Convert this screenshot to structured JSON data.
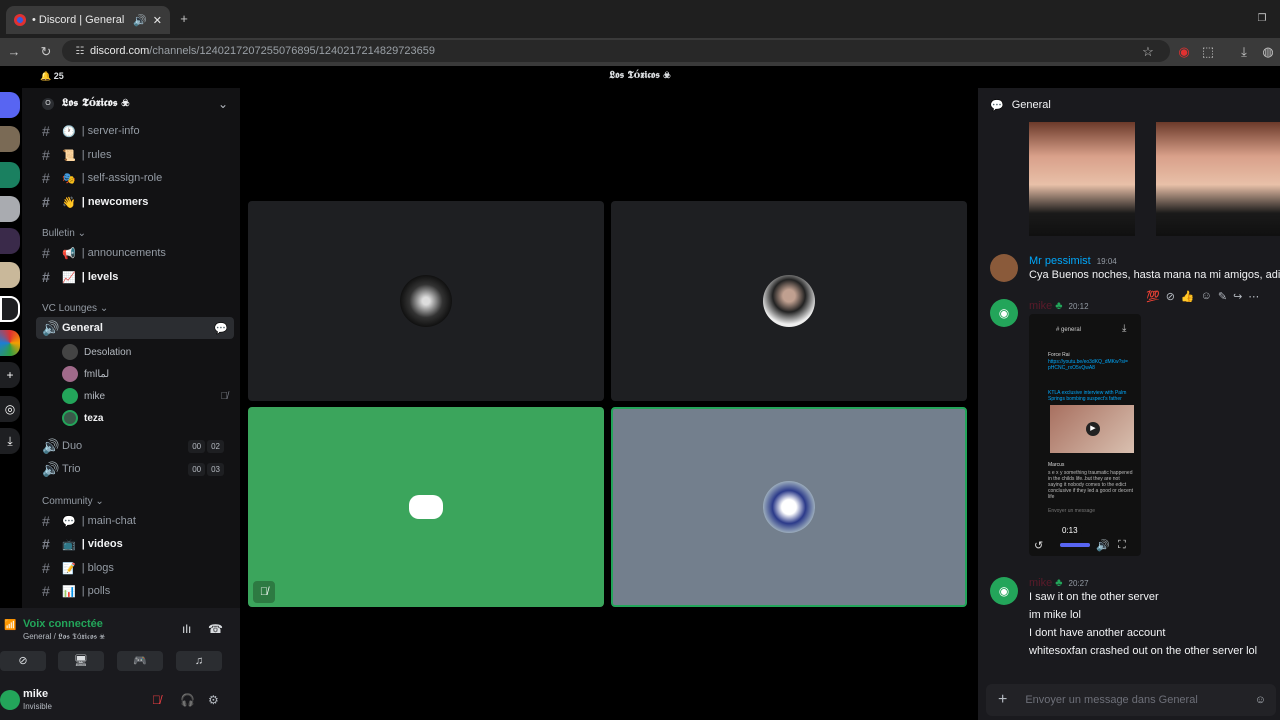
{
  "browser": {
    "tab_title": "• Discord | General | 𝕷𝖔𝖘 𝕿ó...",
    "url_host": "discord.com",
    "url_path": "/channels/1240217207255076895/1240217214829723659"
  },
  "top": {
    "notif_count": "25",
    "server_title": "𝕷𝖔𝖘 𝕿ó𝖝𝖎𝖈𝖔𝖘 ☣"
  },
  "sidebar": {
    "server_name": "𝕷𝖔𝖘 𝕿ó𝖝𝖎𝖈𝖔𝖘 ☣",
    "channels": [
      {
        "label": "| server-info",
        "emoji": "🕐"
      },
      {
        "label": "| rules",
        "emoji": "📜"
      },
      {
        "label": "| self-assign-role",
        "emoji": "🎭"
      },
      {
        "label": "| newcomers",
        "emoji": "👋"
      }
    ],
    "cat_bulletin": "Bulletin",
    "bulletin": [
      {
        "label": "| announcements",
        "emoji": "📢"
      },
      {
        "label": "| levels",
        "emoji": "📈"
      }
    ],
    "cat_vc": "VC Lounges",
    "vc_general": "General",
    "voice_users": [
      "Desolation",
      "fmlلما",
      "mike",
      "teza"
    ],
    "vc_duo": "Duo",
    "duo_counts": [
      "00",
      "02"
    ],
    "vc_trio": "Trio",
    "trio_counts": [
      "00",
      "03"
    ],
    "cat_community": "Community",
    "community": [
      {
        "label": "| main-chat",
        "emoji": "💬"
      },
      {
        "label": "| videos",
        "emoji": "📺"
      },
      {
        "label": "| blogs",
        "emoji": "📝"
      },
      {
        "label": "| polls",
        "emoji": "📊"
      }
    ]
  },
  "voice_panel": {
    "status": "Voix connectée",
    "location": "General / 𝕷𝖔𝖘 𝕿ó𝖝𝖎𝖈𝖔𝖘 ☣"
  },
  "user_panel": {
    "name": "mike",
    "status": "Invisible"
  },
  "chat": {
    "channel": "General",
    "messages": [
      {
        "user": "Mr pessimist",
        "time": "19:04",
        "text": "Cya Buenos noches, hasta mana na mi amigos, adios"
      },
      {
        "user": "mike",
        "time": "20:12",
        "video_time": "0:13"
      },
      {
        "user": "mike",
        "time": "20:27",
        "lines": [
          "I saw it on the other server",
          "im mike lol",
          "I dont have another account",
          "whitesoxfan crashed out on the other server lol"
        ]
      }
    ],
    "embed": {
      "channel": "# general",
      "post_user": "Force Rai",
      "link": "https://youtu.be/eo3dKQ_dMKw?si=pHCNC_rxO5vQwA8",
      "card_title": "KTLA exclusive interview with Palm Springs bombing suspect's father",
      "reply_user": "Marcus",
      "reply_text": "s e x y something traumatic happened in the childs life..but they are not saying it nobody comes to the edict conclusive if they led a good or decent life",
      "compose_hint": "Envoyer un message"
    },
    "composer_placeholder": "Envoyer un message dans General"
  },
  "colors": {
    "green": "#23a55a",
    "blurple": "#5865f2",
    "link": "#00a8fc"
  }
}
